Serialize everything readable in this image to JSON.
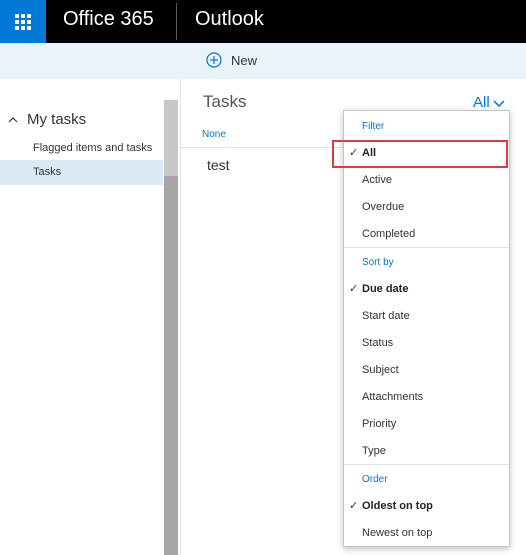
{
  "header": {
    "brand": "Office 365",
    "app_name": "Outlook",
    "waffle_icon": "app-launcher-icon"
  },
  "toolbar": {
    "new_label": "New",
    "new_icon": "plus-circle-icon"
  },
  "sidebar": {
    "group_label": "My tasks",
    "items": [
      {
        "label": "Flagged items and tasks",
        "selected": false
      },
      {
        "label": "Tasks",
        "selected": true
      }
    ]
  },
  "pane": {
    "title": "Tasks",
    "filter_value": "All",
    "sort_label": "None",
    "tasks": [
      {
        "subject": "test"
      }
    ]
  },
  "dropdown": {
    "filter_header": "Filter",
    "filter_options": [
      "All",
      "Active",
      "Overdue",
      "Completed"
    ],
    "filter_selected": "All",
    "sort_header": "Sort by",
    "sort_options": [
      "Due date",
      "Start date",
      "Status",
      "Subject",
      "Attachments",
      "Priority",
      "Type"
    ],
    "sort_selected": "Due date",
    "order_header": "Order",
    "order_options": [
      "Oldest on top",
      "Newest on top"
    ],
    "order_selected": "Oldest on top",
    "check_glyph": "✓"
  },
  "colors": {
    "accent": "#0078d7",
    "topbar": "#000000",
    "highlight": "#e03a3a"
  }
}
